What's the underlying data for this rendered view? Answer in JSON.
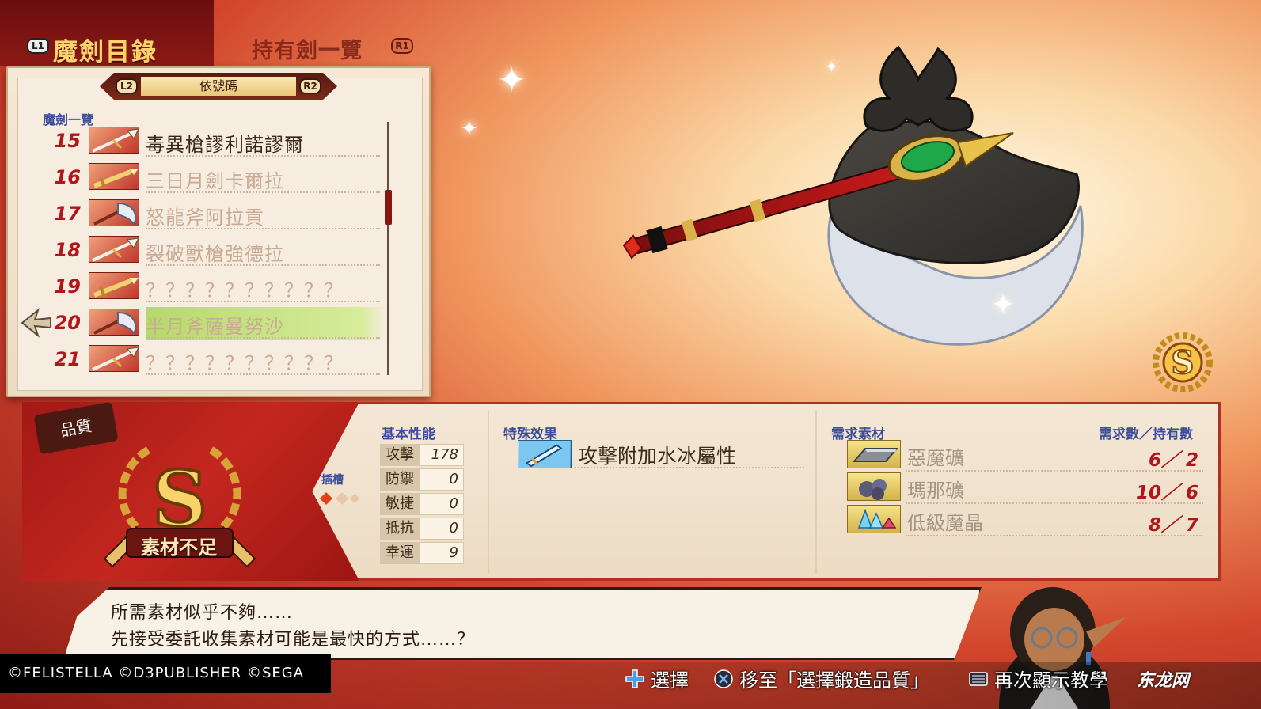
{
  "tabs": {
    "left_button": "L1",
    "active_tab": "魔劍目錄",
    "inactive_tab": "持有劍一覽",
    "right_button": "R1"
  },
  "sort": {
    "left_button": "L2",
    "label": "依號碼",
    "right_button": "R2"
  },
  "list": {
    "heading": "魔劍一覽",
    "items": [
      {
        "number": "15",
        "name": "毒異槍謬利諾謬爾",
        "weapon_icon": "spear-icon"
      },
      {
        "number": "16",
        "name": "三日月劍卡爾拉",
        "weapon_icon": "sword-icon"
      },
      {
        "number": "17",
        "name": "怒龍斧阿拉貢",
        "weapon_icon": "axe-icon"
      },
      {
        "number": "18",
        "name": "裂破獸槍強德拉",
        "weapon_icon": "spear-icon"
      },
      {
        "number": "19",
        "name": "？？？？？？？？？？",
        "weapon_icon": "sword-icon"
      },
      {
        "number": "20",
        "name": "半月斧薩曼努沙",
        "weapon_icon": "axe-icon"
      },
      {
        "number": "21",
        "name": "？？？？？？？？？？",
        "weapon_icon": "spear-icon"
      }
    ],
    "selected_index": 5
  },
  "quality": {
    "tag": "品質",
    "rank": "S",
    "status": "素材不足",
    "slot_label": "插槽"
  },
  "stats": {
    "title": "基本性能",
    "rows": [
      {
        "label": "攻擊",
        "value": "178"
      },
      {
        "label": "防禦",
        "value": "0"
      },
      {
        "label": "敏捷",
        "value": "0"
      },
      {
        "label": "抵抗",
        "value": "0"
      },
      {
        "label": "幸運",
        "value": "9"
      }
    ]
  },
  "special": {
    "title": "特殊效果",
    "effect": "攻擊附加水冰屬性"
  },
  "materials": {
    "title": "需求素材",
    "count_header": "需求數／持有數",
    "items": [
      {
        "name": "惡魔礦",
        "count": "6／ 2",
        "icon": "ingot-icon"
      },
      {
        "name": "瑪那礦",
        "count": "10／ 6",
        "icon": "ore-icon"
      },
      {
        "name": "低級魔晶",
        "count": "8／ 7",
        "icon": "crystal-icon"
      }
    ]
  },
  "dialogue": {
    "line1": "所需素材似乎不夠……",
    "line2": "先接受委託收集素材可能是最快的方式……？"
  },
  "footer": {
    "copyright": "©FELISTELLA ©D3PUBLISHER ©SEGA",
    "hint_select": "選擇",
    "hint_move": "移至「選擇鍛造品質」",
    "hint_tutorial": "再次顯示教學",
    "watermark": "东龙网"
  },
  "colors": {
    "accent_red": "#b0161a",
    "gold": "#ffd36a",
    "blue_label": "#3b4c9a",
    "selected_row": "#b6d96a"
  }
}
